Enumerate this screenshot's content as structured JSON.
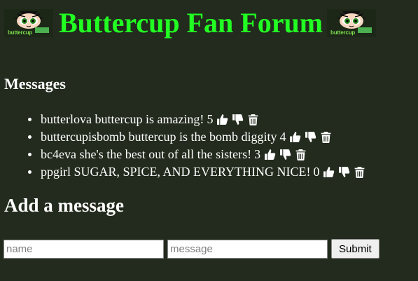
{
  "header": {
    "title": "Buttercup Fan Forum",
    "logo_text": "buttercup"
  },
  "messages": {
    "heading": "Messages",
    "items": [
      {
        "user": "butterlova",
        "text": "buttercup is amazing!",
        "score": "5"
      },
      {
        "user": "buttercupisbomb",
        "text": "buttercup is the bomb diggity",
        "score": "4"
      },
      {
        "user": "bc4eva",
        "text": "she's the best out of all the sisters!",
        "score": "3"
      },
      {
        "user": "ppgirl",
        "text": "SUGAR, SPICE, AND EVERYTHING NICE!",
        "score": "0"
      }
    ]
  },
  "add_message": {
    "heading": "Add a message",
    "name_placeholder": "name",
    "message_placeholder": "message",
    "submit_label": "Submit"
  },
  "icons": {
    "like": "thumbs-up-icon",
    "dislike": "thumbs-down-icon",
    "delete": "trash-icon"
  },
  "colors": {
    "background": "#222b1d",
    "title": "#22ff22",
    "text": "#ffffff"
  }
}
